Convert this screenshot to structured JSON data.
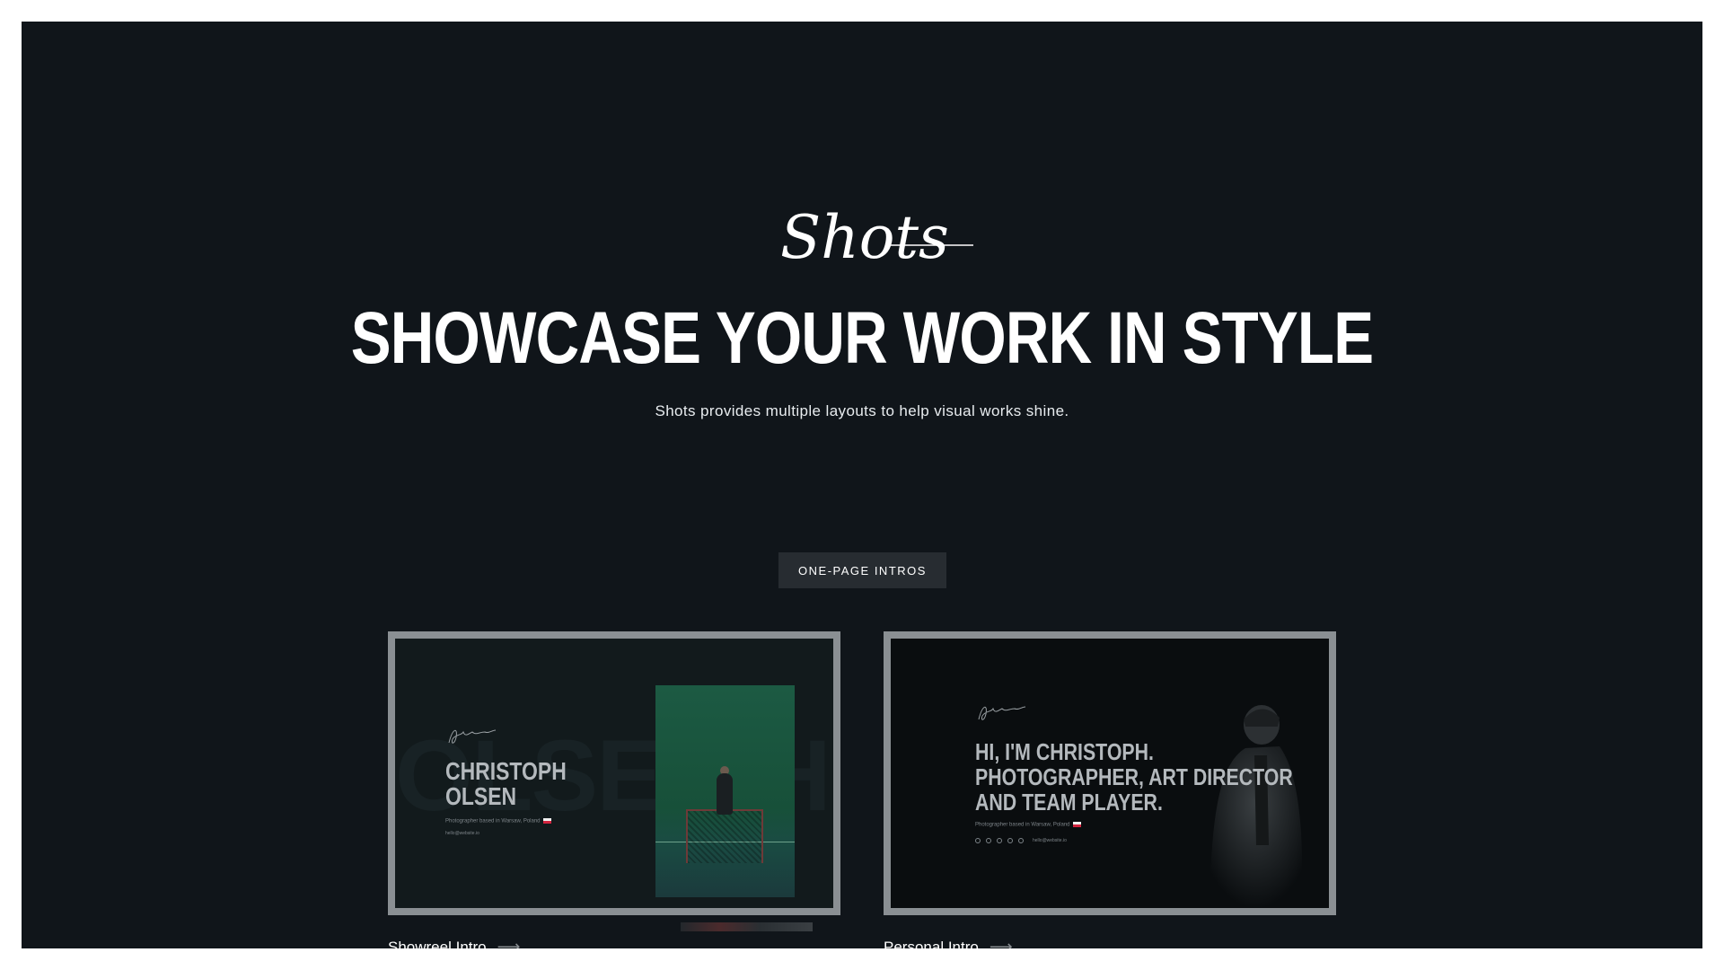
{
  "brand": {
    "logo_text": "Shots"
  },
  "hero": {
    "headline": "SHOWCASE YOUR WORK IN STYLE",
    "subline": "Shots provides multiple layouts to help visual works shine."
  },
  "section": {
    "badge": "ONE-PAGE INTROS"
  },
  "cards": [
    {
      "caption": "Showreel Intro",
      "preview": {
        "title_line1": "CHRISTOPH",
        "title_line2": "OLSEN",
        "ghost_text": "OLSEN HB",
        "meta": "Photographer based in Warsaw, Poland",
        "email": "hello@website.io"
      }
    },
    {
      "caption": "Personal Intro",
      "preview": {
        "title_line1": "HI, I'M CHRISTOPH.",
        "title_line2": "PHOTOGRAPHER, ART DIRECTOR",
        "title_line3": "AND TEAM PLAYER.",
        "meta": "Photographer based in Warsaw, Poland",
        "email": "hello@website.io",
        "social_icons": [
          "instagram-icon",
          "twitter-icon",
          "vimeo-icon",
          "youtube-icon",
          "dribbble-icon"
        ]
      }
    }
  ],
  "colors": {
    "page_bg": "#10151a",
    "badge_bg": "#272c31",
    "card_frame": "#8a8f93",
    "text": "#ffffff"
  },
  "icons": {
    "caption_arrow": "arrow-right-icon"
  }
}
